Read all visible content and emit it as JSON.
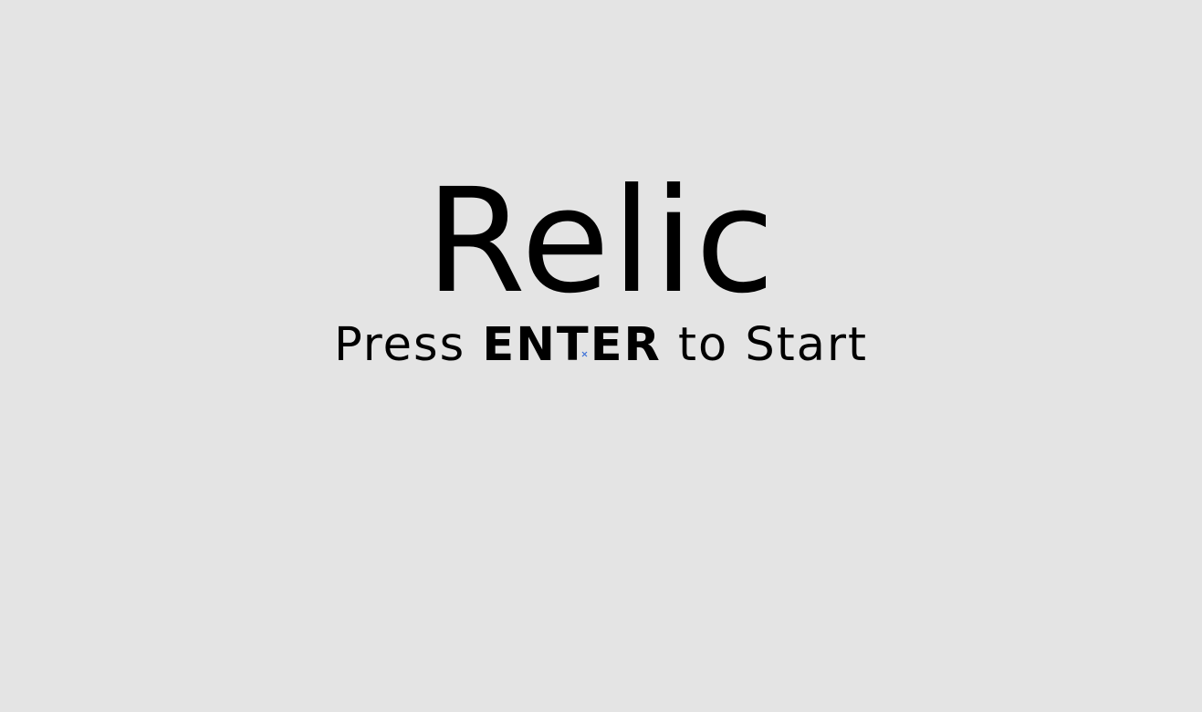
{
  "title_screen": {
    "title": "Relic",
    "prompt": {
      "before": "Press ",
      "key": "ENTER",
      "after": " to Start"
    }
  },
  "colors": {
    "background": "#e4e4e4",
    "text": "#000000",
    "cursor": "#3b6fd8"
  },
  "icons": {
    "cursor": "crosshair-cursor-icon"
  }
}
